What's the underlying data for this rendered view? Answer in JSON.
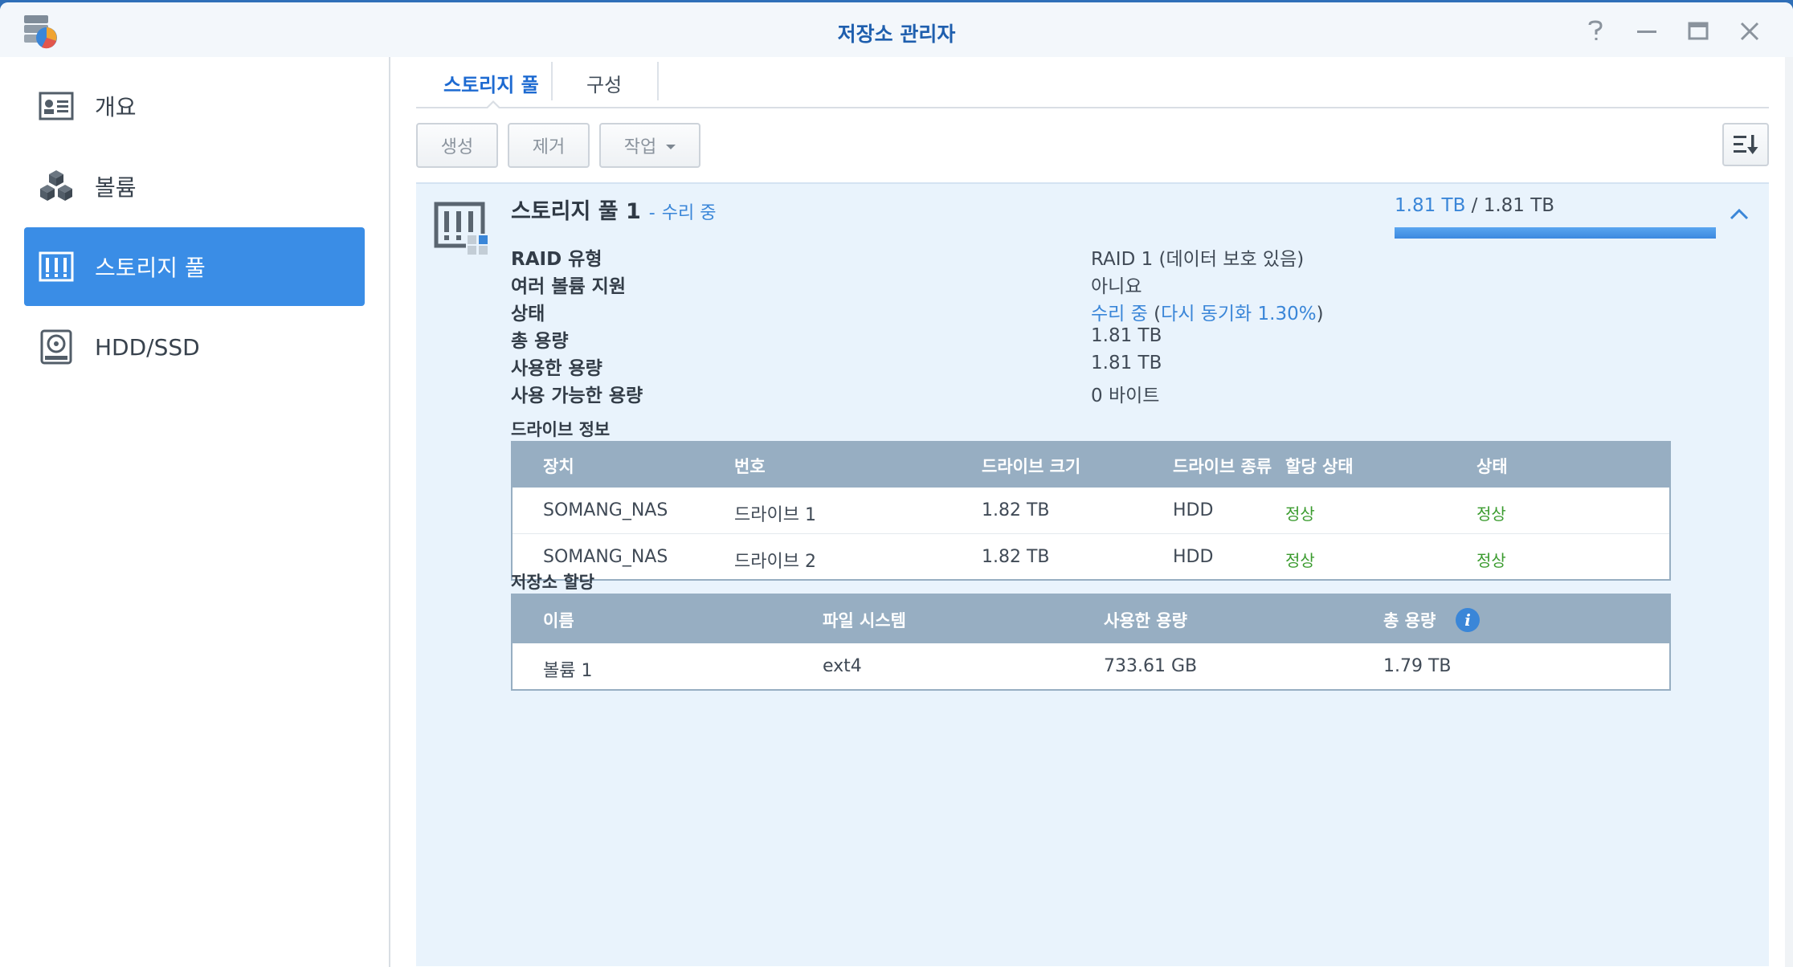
{
  "window": {
    "title": "저장소 관리자",
    "controls": [
      "help-icon",
      "minimize-icon",
      "maximize-icon",
      "close-icon"
    ]
  },
  "sidebar": {
    "items": [
      {
        "label": "개요",
        "icon": "overview-icon",
        "active": false
      },
      {
        "label": "볼륨",
        "icon": "volume-cubes-icon",
        "active": false
      },
      {
        "label": "스토리지 풀",
        "icon": "storage-pool-icon",
        "active": true
      },
      {
        "label": "HDD/SSD",
        "icon": "hdd-icon",
        "active": false
      }
    ]
  },
  "tabs": [
    {
      "label": "스토리지 풀",
      "active": true
    },
    {
      "label": "구성",
      "active": false
    }
  ],
  "toolbar": {
    "create_label": "생성",
    "remove_label": "제거",
    "action_label": "작업",
    "sort_icon": "sort-icon"
  },
  "pool": {
    "name": "스토리지 풀 1",
    "dash": "-",
    "status": "수리 중",
    "usage_used": "1.81 TB",
    "usage_sep": " / ",
    "usage_total": "1.81 TB",
    "usage_fraction": 1.0,
    "colors": {
      "accent": "#3a86d8",
      "ok": "#3a9b2e",
      "panel": "#e9f3fc",
      "grid_header": "#97aec2"
    },
    "info": {
      "raid_key": "RAID 유형",
      "raid_val": "RAID 1 (데이터 보호 있음)",
      "multi_key": "여러 볼륨 지원",
      "multi_val": "아니요",
      "status_key": "상태",
      "status_val": "수리 중",
      "status_open": " (",
      "status_sync": "다시 동기화 1.30%",
      "status_close": ")",
      "total_key": "총 용량",
      "total_val": "1.81 TB",
      "used_key": "사용한 용량",
      "used_val": "1.81 TB",
      "avail_key": "사용 가능한 용량",
      "avail_val": "0 바이트"
    },
    "drives_title": "드라이브 정보",
    "drives": {
      "headers": [
        "장치",
        "번호",
        "드라이브 크기",
        "드라이브 종류",
        "할당 상태",
        "상태"
      ],
      "rows": [
        [
          "SOMANG_NAS",
          "드라이브 1",
          "1.82 TB",
          "HDD",
          "정상",
          "정상"
        ],
        [
          "SOMANG_NAS",
          "드라이브 2",
          "1.82 TB",
          "HDD",
          "정상",
          "정상"
        ]
      ]
    },
    "alloc_title": "저장소 할당",
    "alloc": {
      "headers": [
        "이름",
        "파일 시스템",
        "사용한 용량",
        "총 용량"
      ],
      "rows": [
        [
          "볼륨 1",
          "ext4",
          "733.61 GB",
          "1.79 TB"
        ]
      ],
      "info_glyph": "i"
    }
  }
}
